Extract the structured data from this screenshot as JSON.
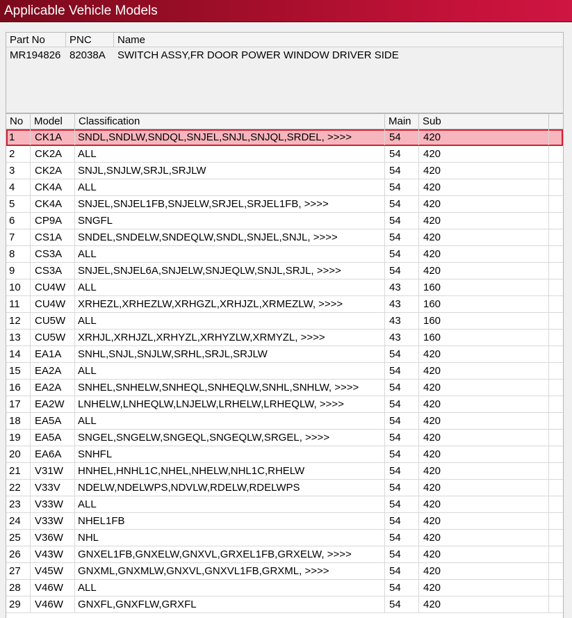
{
  "window": {
    "title": "Applicable Vehicle Models"
  },
  "part_info": {
    "columns": [
      "Part No",
      "PNC",
      "Name"
    ],
    "part_no": "MR194826",
    "pnc": "82038A",
    "name": "SWITCH ASSY,FR DOOR POWER WINDOW DRIVER SIDE"
  },
  "models_grid": {
    "columns": [
      "No",
      "Model",
      "Classification",
      "Main",
      "Sub"
    ],
    "selected_row": 1,
    "rows": [
      {
        "no": "1",
        "model": "CK1A",
        "classification": "SNDL,SNDLW,SNDQL,SNJEL,SNJL,SNJQL,SRDEL,  >>>>",
        "main": "54",
        "sub": "420"
      },
      {
        "no": "2",
        "model": "CK2A",
        "classification": "ALL",
        "main": "54",
        "sub": "420"
      },
      {
        "no": "3",
        "model": "CK2A",
        "classification": "SNJL,SNJLW,SRJL,SRJLW",
        "main": "54",
        "sub": "420"
      },
      {
        "no": "4",
        "model": "CK4A",
        "classification": "ALL",
        "main": "54",
        "sub": "420"
      },
      {
        "no": "5",
        "model": "CK4A",
        "classification": "SNJEL,SNJEL1FB,SNJELW,SRJEL,SRJEL1FB,  >>>>",
        "main": "54",
        "sub": "420"
      },
      {
        "no": "6",
        "model": "CP9A",
        "classification": "SNGFL",
        "main": "54",
        "sub": "420"
      },
      {
        "no": "7",
        "model": "CS1A",
        "classification": "SNDEL,SNDELW,SNDEQLW,SNDL,SNJEL,SNJL,  >>>>",
        "main": "54",
        "sub": "420"
      },
      {
        "no": "8",
        "model": "CS3A",
        "classification": "ALL",
        "main": "54",
        "sub": "420"
      },
      {
        "no": "9",
        "model": "CS3A",
        "classification": "SNJEL,SNJEL6A,SNJELW,SNJEQLW,SNJL,SRJL,  >>>>",
        "main": "54",
        "sub": "420"
      },
      {
        "no": "10",
        "model": "CU4W",
        "classification": "ALL",
        "main": "43",
        "sub": "160"
      },
      {
        "no": "11",
        "model": "CU4W",
        "classification": "XRHEZL,XRHEZLW,XRHGZL,XRHJZL,XRMEZLW,  >>>>",
        "main": "43",
        "sub": "160"
      },
      {
        "no": "12",
        "model": "CU5W",
        "classification": "ALL",
        "main": "43",
        "sub": "160"
      },
      {
        "no": "13",
        "model": "CU5W",
        "classification": "XRHJL,XRHJZL,XRHYZL,XRHYZLW,XRMYZL,  >>>>",
        "main": "43",
        "sub": "160"
      },
      {
        "no": "14",
        "model": "EA1A",
        "classification": "SNHL,SNJL,SNJLW,SRHL,SRJL,SRJLW",
        "main": "54",
        "sub": "420"
      },
      {
        "no": "15",
        "model": "EA2A",
        "classification": "ALL",
        "main": "54",
        "sub": "420"
      },
      {
        "no": "16",
        "model": "EA2A",
        "classification": "SNHEL,SNHELW,SNHEQL,SNHEQLW,SNHL,SNHLW,  >>>>",
        "main": "54",
        "sub": "420"
      },
      {
        "no": "17",
        "model": "EA2W",
        "classification": "LNHELW,LNHEQLW,LNJELW,LRHELW,LRHEQLW,  >>>>",
        "main": "54",
        "sub": "420"
      },
      {
        "no": "18",
        "model": "EA5A",
        "classification": "ALL",
        "main": "54",
        "sub": "420"
      },
      {
        "no": "19",
        "model": "EA5A",
        "classification": "SNGEL,SNGELW,SNGEQL,SNGEQLW,SRGEL,  >>>>",
        "main": "54",
        "sub": "420"
      },
      {
        "no": "20",
        "model": "EA6A",
        "classification": "SNHFL",
        "main": "54",
        "sub": "420"
      },
      {
        "no": "21",
        "model": "V31W",
        "classification": "HNHEL,HNHL1C,NHEL,NHELW,NHL1C,RHELW",
        "main": "54",
        "sub": "420"
      },
      {
        "no": "22",
        "model": "V33V",
        "classification": "NDELW,NDELWPS,NDVLW,RDELW,RDELWPS",
        "main": "54",
        "sub": "420"
      },
      {
        "no": "23",
        "model": "V33W",
        "classification": "ALL",
        "main": "54",
        "sub": "420"
      },
      {
        "no": "24",
        "model": "V33W",
        "classification": "NHEL1FB",
        "main": "54",
        "sub": "420"
      },
      {
        "no": "25",
        "model": "V36W",
        "classification": "NHL",
        "main": "54",
        "sub": "420"
      },
      {
        "no": "26",
        "model": "V43W",
        "classification": "GNXEL1FB,GNXELW,GNXVL,GRXEL1FB,GRXELW,  >>>>",
        "main": "54",
        "sub": "420"
      },
      {
        "no": "27",
        "model": "V45W",
        "classification": "GNXML,GNXMLW,GNXVL,GNXVL1FB,GRXML,  >>>>",
        "main": "54",
        "sub": "420"
      },
      {
        "no": "28",
        "model": "V46W",
        "classification": "ALL",
        "main": "54",
        "sub": "420"
      },
      {
        "no": "29",
        "model": "V46W",
        "classification": "GNXFL,GNXFLW,GRXFL",
        "main": "54",
        "sub": "420"
      }
    ]
  },
  "colors": {
    "title_bar": "#a40e2a",
    "selected_row_bg": "#f7b6bd",
    "selected_row_border": "#d41e35"
  }
}
